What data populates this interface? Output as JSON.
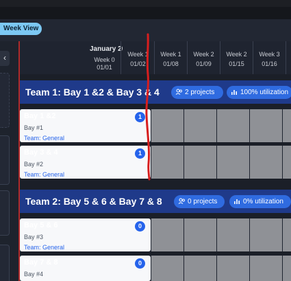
{
  "toolbar": {
    "view_button": "Week View"
  },
  "sidebar": {
    "collapse_glyph": "‹",
    "icons": [
      "chevron-left-icon"
    ]
  },
  "header": {
    "month": "January 20",
    "weeks": [
      {
        "week": "Week 0",
        "date": "01/01"
      },
      {
        "week": "Week 1",
        "date": "01/02"
      },
      {
        "week": "Week 1",
        "date": "01/08"
      },
      {
        "week": "Week 2",
        "date": "01/09"
      },
      {
        "week": "Week 2",
        "date": "01/15"
      },
      {
        "week": "Week 3",
        "date": "01/16"
      }
    ]
  },
  "teams": [
    {
      "title": "Team 1: Bay 1 &2 & Bay 3 & 4",
      "projects": "2 projects",
      "utilization": "100% utilization",
      "bays": [
        {
          "name": "Bay 1 &2",
          "number": "Bay #1",
          "team": "Team: General",
          "count": "1"
        },
        {
          "name": "Bay 3 & 4",
          "number": "Bay #2",
          "team": "Team: General",
          "count": "1"
        }
      ]
    },
    {
      "title": "Team 2: Bay 5 & 6 & Bay 7 & 8",
      "projects": "0 projects",
      "utilization": "0% utilization",
      "bays": [
        {
          "name": "Bay 5 & 6",
          "number": "Bay #3",
          "team": "Team: General",
          "count": "0"
        },
        {
          "name": "Bay 7 & 8",
          "number": "Bay #4",
          "team": "",
          "count": "0"
        }
      ]
    }
  ],
  "colors": {
    "team_bar": "#1f3a8a",
    "pill": "#2f6be0",
    "badge": "#2563eb",
    "week_view": "#7cc8f3",
    "annotation": "#d81e1e"
  }
}
